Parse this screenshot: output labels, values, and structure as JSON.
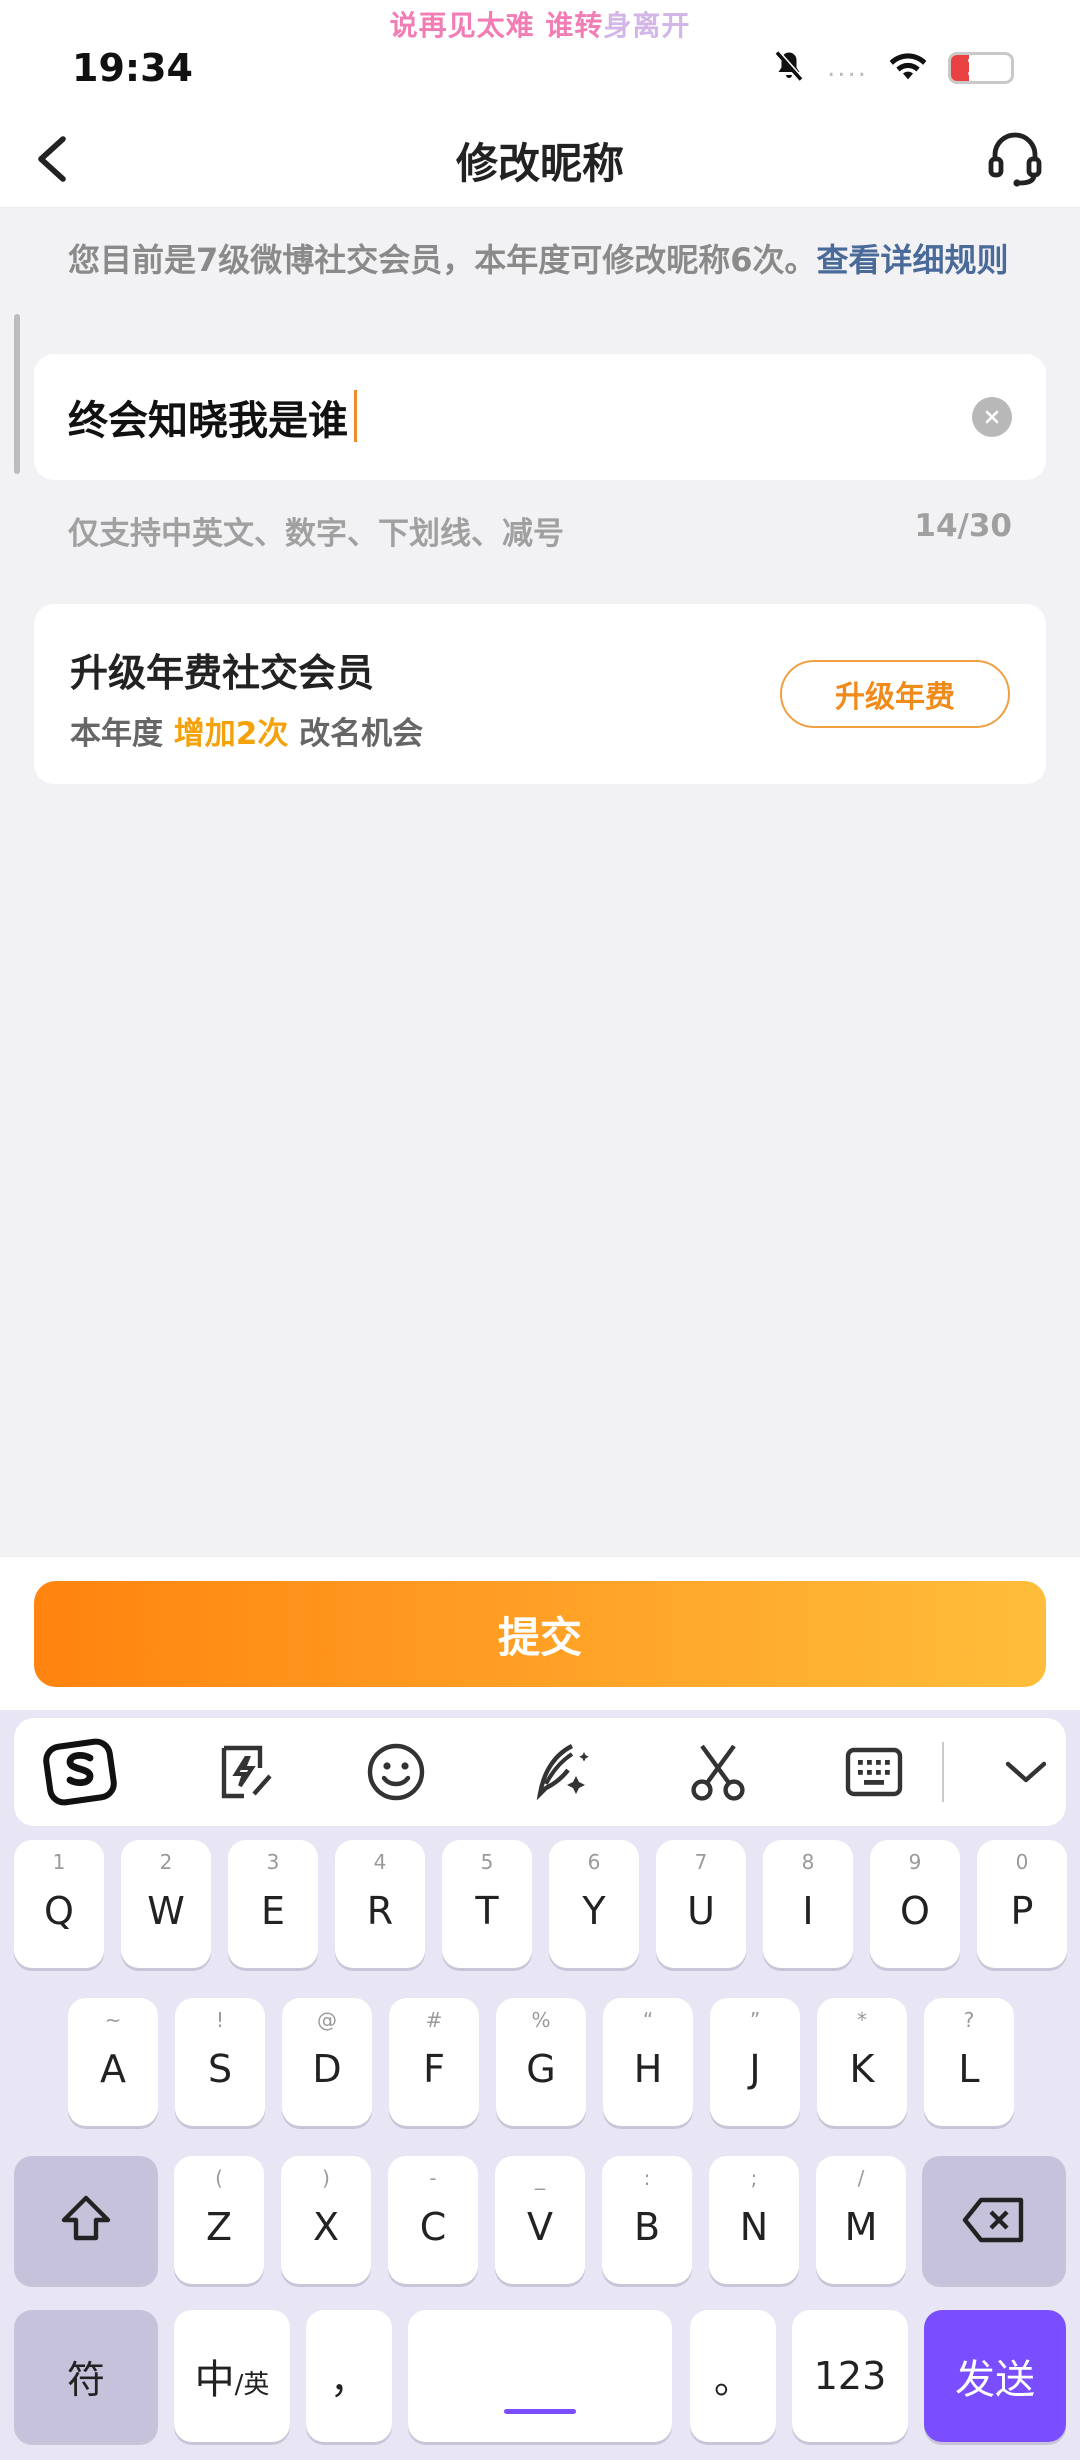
{
  "status": {
    "lyric_part1": "说再见太难 谁转",
    "lyric_part2": "身离开",
    "time": "19:34",
    "dots": "....",
    "battery": "16"
  },
  "nav": {
    "title": "修改昵称"
  },
  "notice": {
    "text": "您目前是7级微博社交会员，本年度可修改昵称6次。",
    "link": "查看详细规则"
  },
  "nickname": {
    "value": "终会知晓我是谁",
    "hint": "仅支持中英文、数字、下划线、减号",
    "count": "14/30"
  },
  "upgrade": {
    "title": "升级年费社交会员",
    "desc_prefix": "本年度",
    "desc_highlight": "增加2次",
    "desc_suffix": "改名机会",
    "button": "升级年费"
  },
  "submit": {
    "label": "提交"
  },
  "keyboard": {
    "toolbar": [
      "sogou-logo-icon",
      "quick-phrase-icon",
      "emoji-icon",
      "handwriting-icon",
      "scissors-icon",
      "keyboard-icon",
      "chevron-down-icon"
    ],
    "row1": [
      {
        "k": "Q",
        "h": "1"
      },
      {
        "k": "W",
        "h": "2"
      },
      {
        "k": "E",
        "h": "3"
      },
      {
        "k": "R",
        "h": "4"
      },
      {
        "k": "T",
        "h": "5"
      },
      {
        "k": "Y",
        "h": "6"
      },
      {
        "k": "U",
        "h": "7"
      },
      {
        "k": "I",
        "h": "8"
      },
      {
        "k": "O",
        "h": "9"
      },
      {
        "k": "P",
        "h": "0"
      }
    ],
    "row2": [
      {
        "k": "A",
        "h": "~"
      },
      {
        "k": "S",
        "h": "!"
      },
      {
        "k": "D",
        "h": "@"
      },
      {
        "k": "F",
        "h": "#"
      },
      {
        "k": "G",
        "h": "%"
      },
      {
        "k": "H",
        "h": "“"
      },
      {
        "k": "J",
        "h": "”"
      },
      {
        "k": "K",
        "h": "*"
      },
      {
        "k": "L",
        "h": "?"
      }
    ],
    "row3": [
      {
        "k": "Z",
        "h": "("
      },
      {
        "k": "X",
        "h": ")"
      },
      {
        "k": "C",
        "h": "-"
      },
      {
        "k": "V",
        "h": "_"
      },
      {
        "k": "B",
        "h": ":"
      },
      {
        "k": "N",
        "h": ";"
      },
      {
        "k": "M",
        "h": "/"
      }
    ],
    "symbol_key": "符",
    "lang_main": "中",
    "lang_sub": "/英",
    "comma": "，",
    "period": "。",
    "num_key": "123",
    "send_key": "发送",
    "accent_color": "#7a4dff"
  }
}
